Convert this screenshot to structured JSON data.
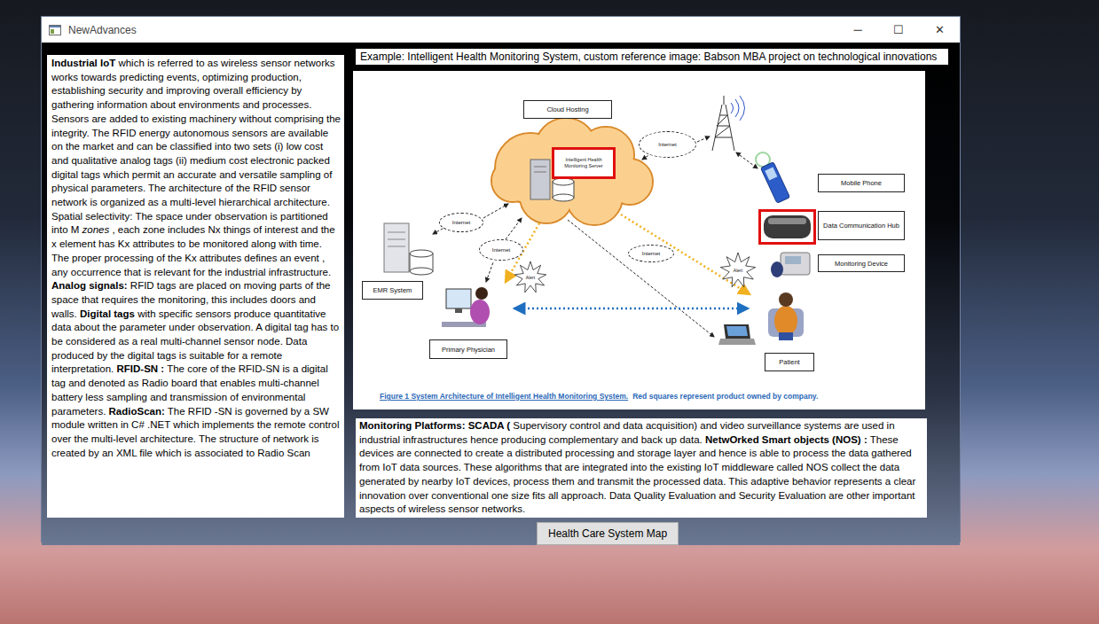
{
  "window": {
    "title": "NewAdvances",
    "controls": [
      "─",
      "☐",
      "✕"
    ]
  },
  "left_panel": {
    "segments": [
      {
        "text": "Industrial IoT",
        "kind": "bold"
      },
      {
        "text": "  which is referred to as wireless sensor networks works towards predicting events, optimizing production, establishing security and improving overall efficiency by gathering information about environments and processes.  Sensors are added to existing machinery without comprising the integrity.  The RFID energy autonomous sensors are available on the market and can be classified into two sets (i) low cost and qualitative analog tags (ii) medium cost electronic packed digital tags which permit an accurate and versatile sampling of physical parameters.      The architecture of the RFID sensor network is organized as a multi-level hierarchical architecture.  Spatial selectivity: The space under observation is partitioned into M  ",
        "kind": "plain"
      },
      {
        "text": "zones",
        "kind": "italic"
      },
      {
        "text": " , each zone includes Nx things of interest and the x element has Kx attributes to be monitored along with time.  The proper processing of the Kx attributes defines an event , any occurrence that is relevant for the industrial infrastructure. ",
        "kind": "plain"
      },
      {
        "text": "Analog signals:",
        "kind": "bold"
      },
      {
        "text": "  RFID tags are placed on moving parts of the space that requires the monitoring, this includes doors and walls.     ",
        "kind": "plain"
      },
      {
        "text": "Digital tags",
        "kind": "bold"
      },
      {
        "text": "  with specific sensors produce quantitative data about the parameter under observation. A digital tag has to be considered as a real multi-channel sensor node.  Data produced by the digital tags is suitable for a remote interpretation.    ",
        "kind": "plain"
      },
      {
        "text": "RFID-SN :",
        "kind": "bold"
      },
      {
        "text": "  The core of the RFID-SN is a digital tag and denoted as Radio board that enables multi-channel battery less sampling and transmission of environmental parameters.      ",
        "kind": "plain"
      },
      {
        "text": "RadioScan:",
        "kind": "bold"
      },
      {
        "text": "  The RFID -SN is governed by a SW module written in C# .NET which implements the remote control over the multi-level architecture. The structure of network is created by an XML file which is associated to Radio Scan",
        "kind": "plain"
      }
    ]
  },
  "caption": "Example: Intelligent Health Monitoring System, custom reference image:  Babson MBA project on technological innovations",
  "diagram": {
    "cloud_label": "Cloud Hosting",
    "server_label": "Intelligent Health Monitoring Server",
    "internet_labels": [
      "Internet",
      "Internet",
      "Internet",
      "Internet"
    ],
    "alerts": [
      "Alert",
      "Alert"
    ],
    "labels": {
      "mobile": "Mobile Phone",
      "hub": "Data Communication Hub",
      "monitor": "Monitoring Device",
      "emr": "EMR System",
      "physician": "Primary Physician",
      "patient": "Patient"
    },
    "owned": {
      "server": true,
      "hub": true
    },
    "caption_title": "Figure 1 System Architecture of Intelligent Health Monitoring System.",
    "caption_note": "Red squares represent product  owned by company."
  },
  "bottom_panel": {
    "segments": [
      {
        "text": "Monitoring Platforms: SCADA (",
        "kind": "bold"
      },
      {
        "text": "  Supervisory control and data acquisition) and video surveillance systems are used in industrial infrastructures hence producing complementary and back up data.      ",
        "kind": "plain"
      },
      {
        "text": "NetwOrked Smart objects (NOS) :",
        "kind": "bold"
      },
      {
        "text": " These devices are connected to create a distributed processing and storage layer and hence is able to process the data gathered from IoT data sources. These algorithms that are integrated into the existing IoT middleware called NOS collect the data generated by nearby IoT devices, process them and transmit the processed data. This adaptive behavior represents a clear innovation over conventional one size fits all approach.  Data Quality Evaluation and Security Evaluation are other important aspects of wireless sensor networks.",
        "kind": "plain"
      }
    ]
  },
  "button": {
    "label": "Health Care System Map"
  }
}
